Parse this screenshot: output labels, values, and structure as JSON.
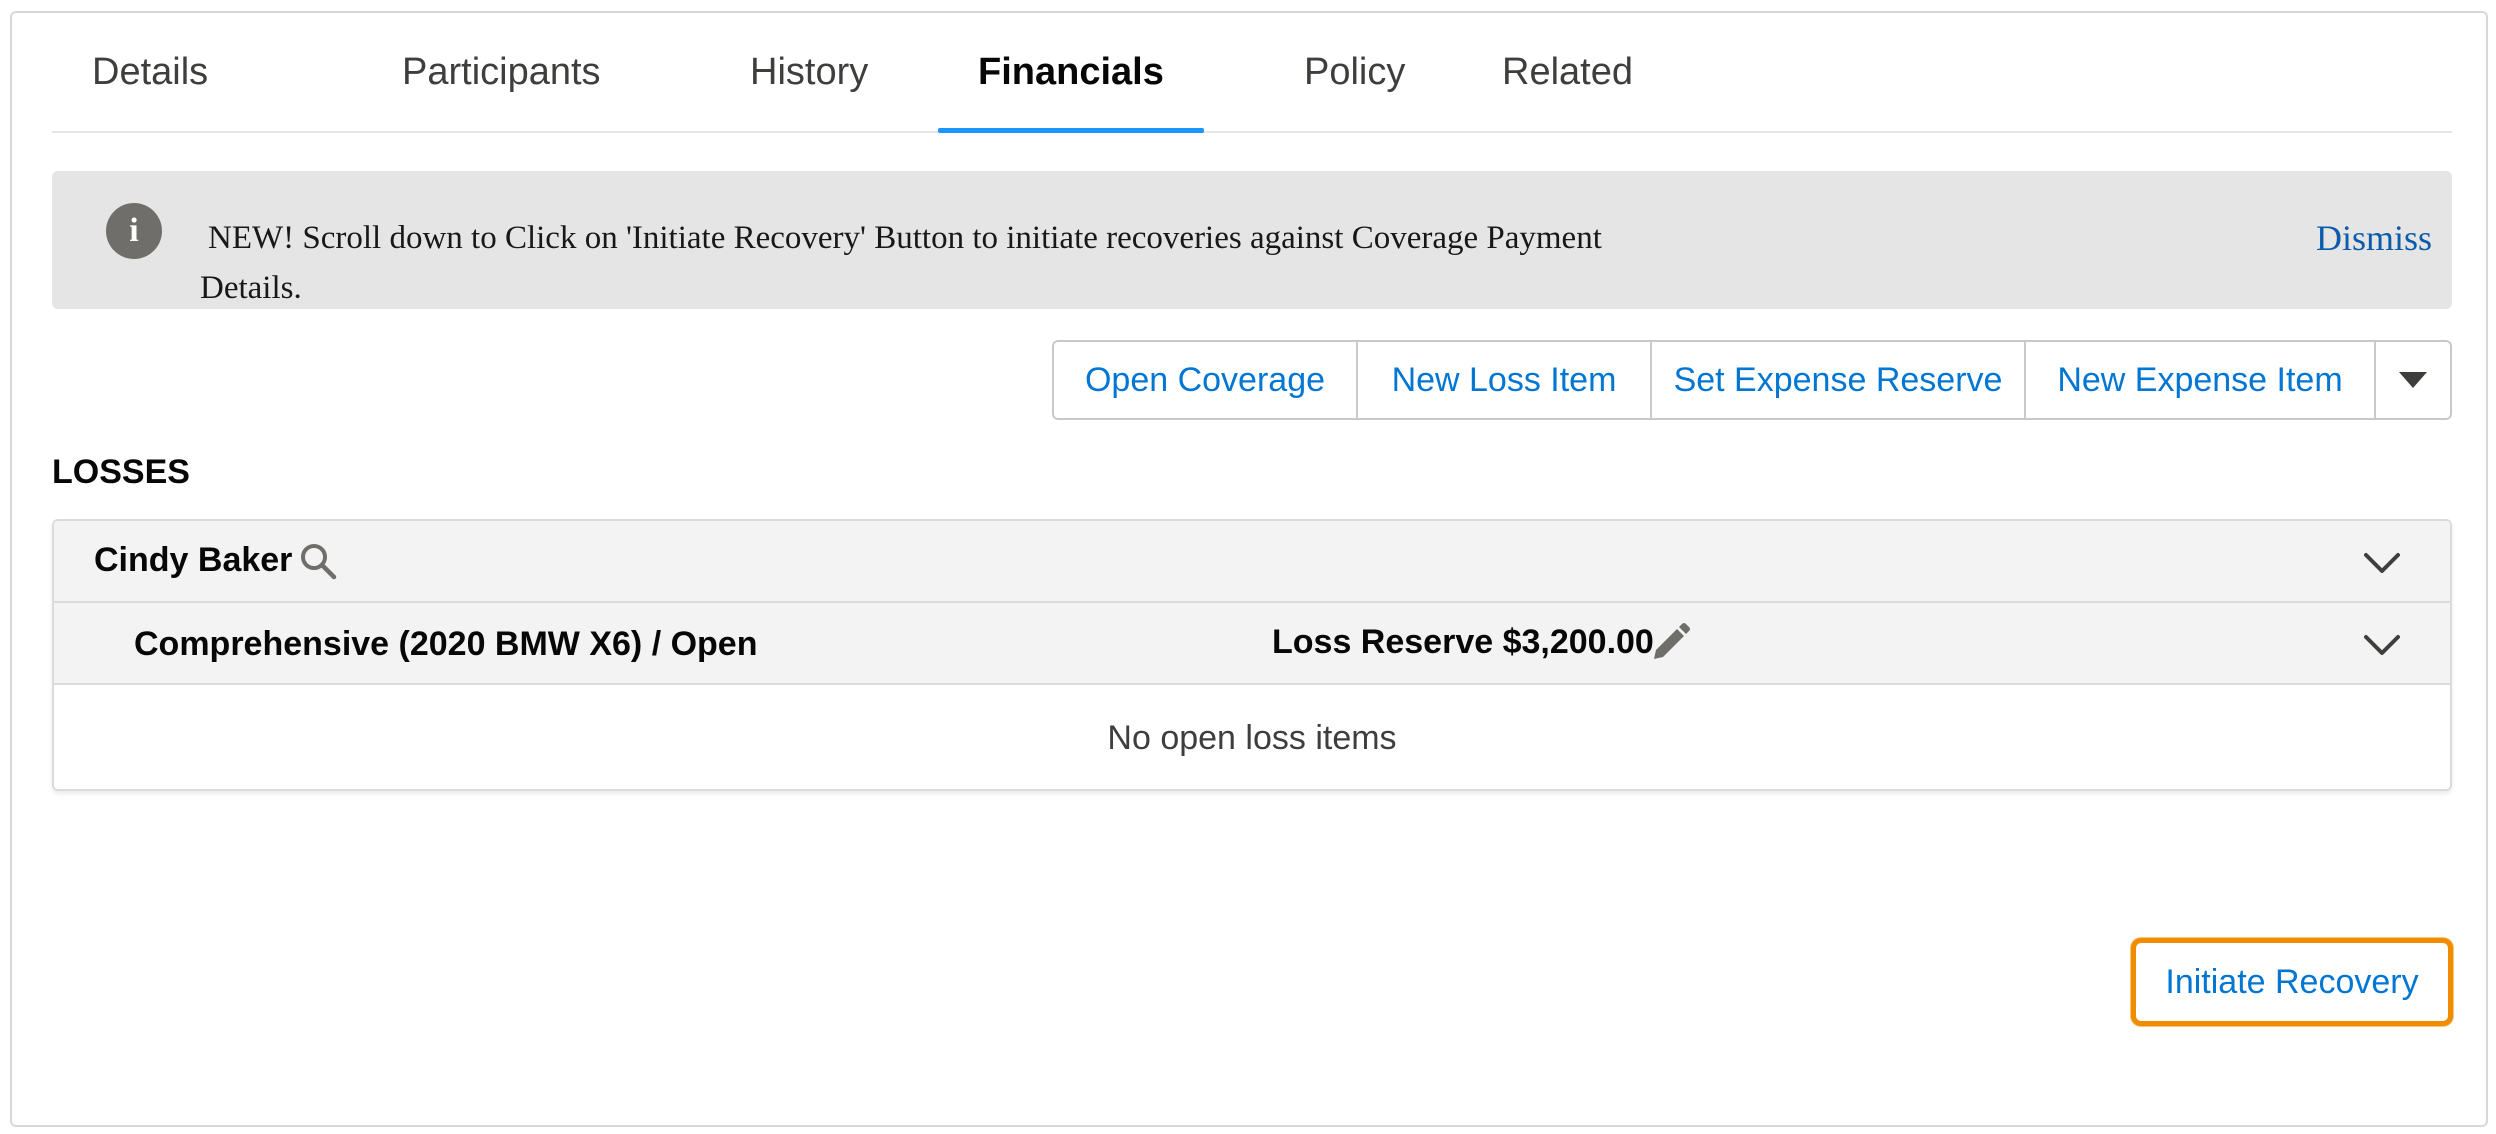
{
  "tabs": [
    {
      "label": "Details"
    },
    {
      "label": "Participants"
    },
    {
      "label": "History"
    },
    {
      "label": "Financials",
      "active": true
    },
    {
      "label": "Policy"
    },
    {
      "label": "Related"
    }
  ],
  "notice": {
    "icon": "info-icon",
    "icon_glyph": "i",
    "text": "NEW! Scroll down to Click on 'Initiate Recovery' Button to initiate recoveries against Coverage Payment Details.",
    "dismiss_label": "Dismiss"
  },
  "actions": {
    "open_coverage": "Open Coverage",
    "new_loss_item": "New Loss Item",
    "set_expense_reserve": "Set Expense Reserve",
    "new_expense_item": "New Expense Item",
    "more_icon": "caret-down-icon"
  },
  "losses": {
    "section_title": "LOSSES",
    "participant": {
      "name": "Cindy Baker",
      "icon": "search-icon",
      "toggle_icon": "chevron-down-icon"
    },
    "coverage": {
      "name": "Comprehensive (2020 BMW X6) / Open",
      "loss_reserve": "Loss Reserve $3,200.00",
      "edit_icon": "pencil-icon",
      "toggle_icon": "chevron-down-icon"
    },
    "empty_text": "No open loss items"
  },
  "recovery": {
    "button_label": "Initiate Recovery"
  },
  "colors": {
    "link_blue": "#0176d3",
    "tab_active_underline": "#1b96ff",
    "notice_bg": "#e5e5e5",
    "focus_outline": "#f08c00"
  }
}
